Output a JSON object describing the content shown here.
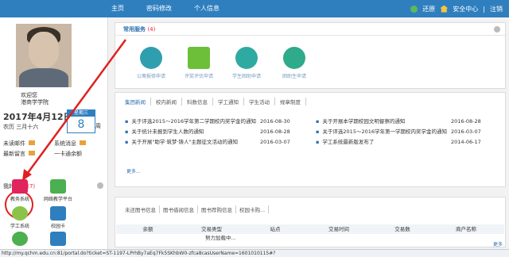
{
  "topbar": {
    "nav": [
      "主页",
      "密码修改",
      "个人信息"
    ],
    "right": [
      "还原",
      "安全中心",
      "注销"
    ]
  },
  "profile": {
    "welcome_line1": "欢迎您",
    "welcome_line2": "港商学学院",
    "date": "2017年4月12日",
    "lunar": "农历 三月十六",
    "weekday_label": "星期三",
    "day": "8",
    "week_suffix": "周"
  },
  "stats": [
    {
      "label": "未读邮件",
      "label2": "系统消息"
    },
    {
      "label": "最新留言",
      "label2": "一卡通余额"
    }
  ],
  "apps": {
    "title": "我的应用",
    "count": "(7)",
    "items": [
      {
        "label": "教务系统",
        "color": "#e0245e"
      },
      {
        "label": "网络教学平台",
        "color": "#4caf50"
      },
      {
        "label": "学工系统",
        "color": "#8bc34a"
      },
      {
        "label": "校园卡",
        "color": "#2f7fbf"
      },
      {
        "label": "",
        "color": "#4caf50"
      },
      {
        "label": "",
        "color": "#2f7fbf"
      }
    ]
  },
  "services": {
    "title": "常用服务",
    "count": "(4)",
    "items": [
      {
        "label": "公寓报修申请",
        "color": "#2f9fb0"
      },
      {
        "label": "评奖评优申请",
        "color": "#6dbf3a"
      },
      {
        "label": "学生困助申请",
        "color": "#2faaa0"
      },
      {
        "label": "困助生申请",
        "color": "#2faa8a"
      }
    ]
  },
  "news": {
    "tabs": [
      "集团新闻",
      "校内新闻",
      "科数信息",
      "学工通知",
      "学生活动",
      "规章制度"
    ],
    "left": [
      {
        "title": "关于评选2015～2016学年第二学期校内奖学金的通知",
        "date": "2016-08-30"
      },
      {
        "title": "关于统计未报到学生人数的通知",
        "date": "2016-08-28"
      },
      {
        "title": "关于开展\"助学·筑梦·铸人\"主题征文活动的通知",
        "date": "2016-03-07"
      }
    ],
    "right": [
      {
        "title": "关于开展本学期校园文明督察的通知",
        "date": "2016-08-28"
      },
      {
        "title": "关于评选2015～2016学年第一学期校内奖学金的通知",
        "date": "2016-03-07"
      },
      {
        "title": "学工系统最新版发布了",
        "date": "2014-06-17"
      }
    ],
    "more": "更多..."
  },
  "library": {
    "tabs": [
      "未还图书信息",
      "图书借阅信息",
      "图书荐购信息",
      "校园卡购..."
    ],
    "columns": [
      "余额",
      "交易类型",
      "站点",
      "交易时间",
      "交易数",
      "商户名称"
    ],
    "loading": "努力加载中...",
    "more": "更多"
  },
  "status_url": "http://my.qchm.edu.cn:81/portal.do?ticket=ST-1197-LPrhBy7aEq7Fk5SKhbW0-zfca8casUserName=1601010115#?",
  "colors": {
    "brand": "#2f7fbf",
    "accent": "#e02020"
  }
}
